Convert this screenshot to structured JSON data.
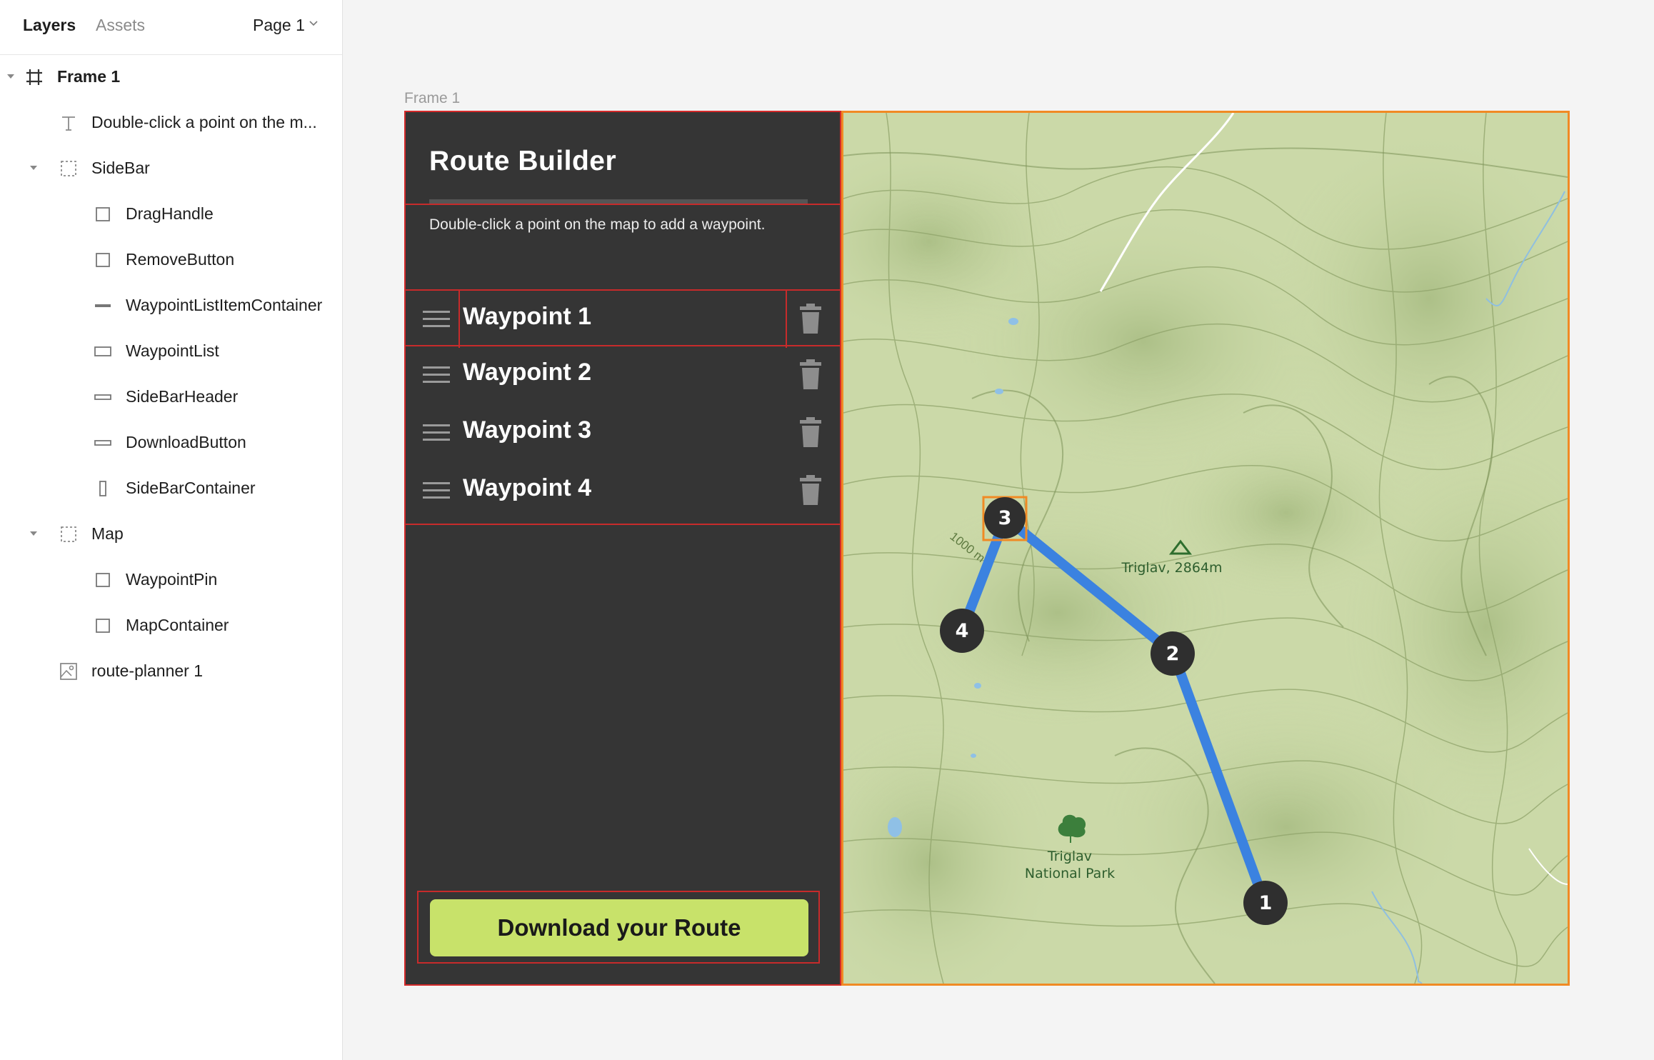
{
  "layers_panel": {
    "tabs": [
      {
        "label": "Layers",
        "active": true
      },
      {
        "label": "Assets",
        "active": false
      }
    ],
    "page_selector": "Page 1",
    "layers": [
      {
        "name": "Frame 1",
        "icon": "frame-icon",
        "level": 0,
        "expanded": true
      },
      {
        "name": "Double-click a point on the m...",
        "icon": "text-icon",
        "level": 1
      },
      {
        "name": "SideBar",
        "icon": "group-icon",
        "level": 1,
        "expanded": true
      },
      {
        "name": "DragHandle",
        "icon": "rectangle-icon",
        "level": 2
      },
      {
        "name": "RemoveButton",
        "icon": "rectangle-icon",
        "level": 2
      },
      {
        "name": "WaypointListItemContainer",
        "icon": "line-icon",
        "level": 2
      },
      {
        "name": "WaypointList",
        "icon": "rectangle-icon",
        "level": 2
      },
      {
        "name": "SideBarHeader",
        "icon": "thin-rectangle-icon",
        "level": 2
      },
      {
        "name": "DownloadButton",
        "icon": "thin-rectangle-icon",
        "level": 2
      },
      {
        "name": "SideBarContainer",
        "icon": "tall-rectangle-icon",
        "level": 2
      },
      {
        "name": "Map",
        "icon": "group-icon",
        "level": 1,
        "expanded": true
      },
      {
        "name": "WaypointPin",
        "icon": "rectangle-icon",
        "level": 2
      },
      {
        "name": "MapContainer",
        "icon": "rectangle-icon",
        "level": 2
      },
      {
        "name": "route-planner 1",
        "icon": "image-icon",
        "level": 1
      }
    ]
  },
  "canvas": {
    "frame_label": "Frame 1"
  },
  "sidebar": {
    "title": "Route Builder",
    "instruction": "Double-click a point on the map to add a waypoint.",
    "waypoints": [
      {
        "label": "Waypoint 1"
      },
      {
        "label": "Waypoint 2"
      },
      {
        "label": "Waypoint 3"
      },
      {
        "label": "Waypoint 4"
      }
    ],
    "download_label": "Download your Route"
  },
  "map": {
    "peak_label": "Triglav, 2864m",
    "park_label_line1": "Triglav",
    "park_label_line2": "National Park",
    "contour_label": "1000 m",
    "pins": [
      {
        "number": "1"
      },
      {
        "number": "2"
      },
      {
        "number": "3",
        "selected": true
      },
      {
        "number": "4"
      }
    ],
    "route_color": "#3b82e0",
    "pin_color": "#2f2f2f"
  },
  "colors": {
    "selection_orange": "#f08a24",
    "selection_red": "#d42a2a",
    "sidebar_bg": "#353535",
    "download_button_bg": "#c8e26a"
  }
}
